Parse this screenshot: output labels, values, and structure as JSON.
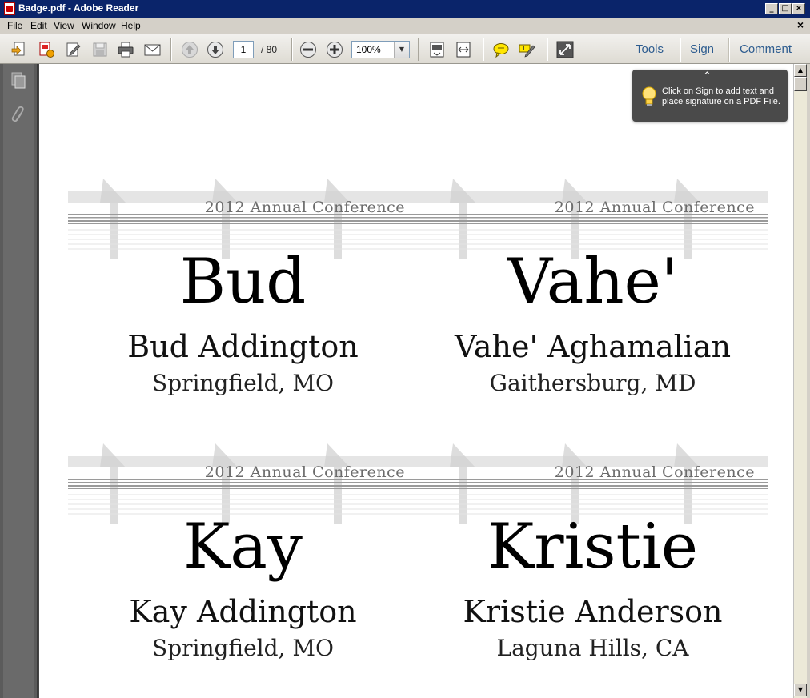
{
  "window": {
    "title": "Badge.pdf - Adobe Reader",
    "controls": {
      "minimize": "_",
      "maximize": "□",
      "close": "×"
    }
  },
  "menu": {
    "items": [
      "File",
      "Edit",
      "View",
      "Window",
      "Help"
    ],
    "close_doc": "×"
  },
  "toolbar": {
    "page_current": "1",
    "page_total": "/ 80",
    "zoom": "100%",
    "links": [
      "Tools",
      "Sign",
      "Comment"
    ]
  },
  "tooltip": {
    "text": "Click on Sign to add text and place signature on a PDF File.",
    "collapse_glyph": "⌃"
  },
  "badges": [
    {
      "conference": "2012 Annual Conference",
      "first": "Bud",
      "full_name": "Bud Addington",
      "city": "Springfield, MO"
    },
    {
      "conference": "2012 Annual Conference",
      "first": "Vahe'",
      "full_name": "Vahe' Aghamalian",
      "city": "Gaithersburg, MD"
    },
    {
      "conference": "2012 Annual Conference",
      "first": "Kay",
      "full_name": "Kay Addington",
      "city": "Springfield, MO"
    },
    {
      "conference": "2012 Annual Conference",
      "first": "Kristie",
      "full_name": "Kristie Anderson",
      "city": "Laguna Hills, CA"
    }
  ],
  "colors": {
    "titlebar": "#0a246a",
    "toolbar_link": "#2d5c8f",
    "nav_panel": "#5b5b5b",
    "tooltip_bg": "#4a4a4a"
  }
}
